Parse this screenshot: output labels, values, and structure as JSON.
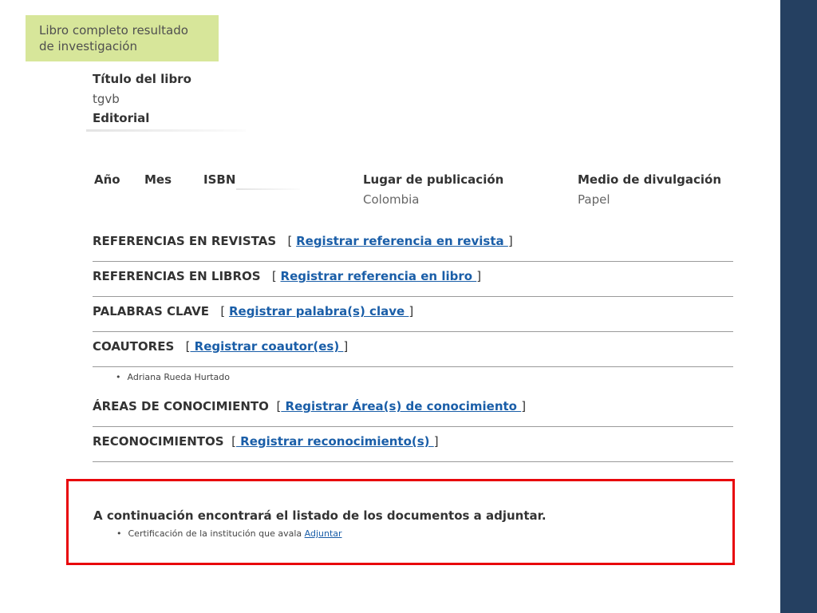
{
  "category_badge": "Libro completo resultado\nde investigación",
  "book": {
    "title_label": "Título del libro",
    "title_value": "tgvb",
    "publisher_label": "Editorial"
  },
  "details": {
    "year_label": "Año",
    "month_label": "Mes",
    "isbn_label": "ISBN",
    "place_label": "Lugar de publicación",
    "place_value": "Colombia",
    "medium_label": "Medio de divulgación",
    "medium_value": "Papel"
  },
  "sections": {
    "journal_refs": {
      "title": "REFERENCIAS EN REVISTAS",
      "link": "Registrar referencia en revista "
    },
    "book_refs": {
      "title": "REFERENCIAS EN LIBROS",
      "link": "Registrar referencia en libro "
    },
    "keywords": {
      "title": "PALABRAS CLAVE",
      "link": "Registrar palabra(s) clave "
    },
    "coauthors": {
      "title": "COAUTORES",
      "link": " Registrar coautor(es) "
    },
    "knowledge_areas": {
      "title": "ÁREAS DE CONOCIMIENTO",
      "link": " Registrar Área(s) de conocimiento "
    },
    "awards": {
      "title": "RECONOCIMIENTOS",
      "link": " Registrar reconocimiento(s) "
    }
  },
  "coauthors_list": [
    "Adriana Rueda Hurtado"
  ],
  "documents": {
    "heading": "A continuación encontrará el listado de los documentos a adjuntar.",
    "items": [
      {
        "label": "Certificación de la institución que avala ",
        "link": "Adjuntar"
      }
    ]
  },
  "colors": {
    "right_bar": "#254061",
    "badge_bg": "#d7e69a",
    "link": "#1a5ea8",
    "highlight_border": "#e8060c"
  }
}
